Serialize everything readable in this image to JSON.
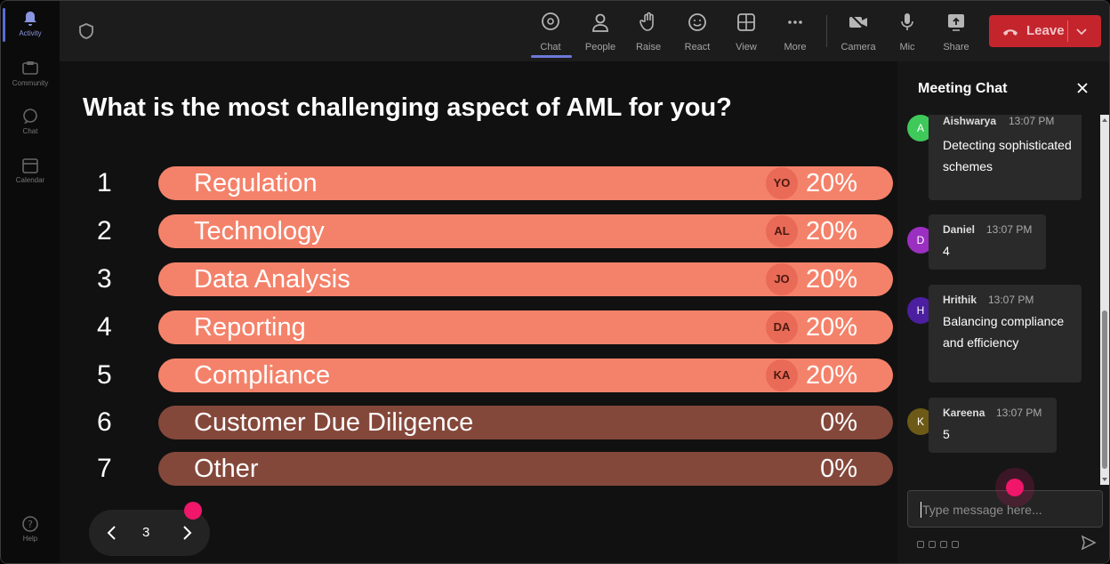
{
  "rail": {
    "items": [
      {
        "label": "Activity",
        "icon": "bell-icon"
      },
      {
        "label": "Community",
        "icon": "community-icon"
      },
      {
        "label": "Chat",
        "icon": "chat-bubble-icon"
      },
      {
        "label": "Calendar",
        "icon": "calendar-icon"
      },
      {
        "label": "Help",
        "icon": "help-icon"
      }
    ]
  },
  "toolbar": {
    "buttons": [
      {
        "label": "Chat",
        "icon": "chat-bubble-icon"
      },
      {
        "label": "People",
        "icon": "person-icon"
      },
      {
        "label": "Raise",
        "icon": "hand-icon"
      },
      {
        "label": "React",
        "icon": "smiley-icon"
      },
      {
        "label": "View",
        "icon": "grid-icon"
      },
      {
        "label": "More",
        "icon": "ellipsis-icon"
      },
      {
        "label": "Camera",
        "icon": "camera-off-icon"
      },
      {
        "label": "Mic",
        "icon": "mic-icon"
      },
      {
        "label": "Share",
        "icon": "share-screen-icon"
      }
    ],
    "leave_label": "Leave"
  },
  "poll": {
    "question": "What is the most challenging aspect of AML for you?",
    "options": [
      {
        "num": "1",
        "label": "Regulation",
        "avatar": "YO",
        "percent": "20%",
        "filled": true
      },
      {
        "num": "2",
        "label": "Technology",
        "avatar": "AL",
        "percent": "20%",
        "filled": true
      },
      {
        "num": "3",
        "label": "Data Analysis",
        "avatar": "JO",
        "percent": "20%",
        "filled": true
      },
      {
        "num": "4",
        "label": "Reporting",
        "avatar": "DA",
        "percent": "20%",
        "filled": true
      },
      {
        "num": "5",
        "label": "Compliance",
        "avatar": "KA",
        "percent": "20%",
        "filled": true
      },
      {
        "num": "6",
        "label": "Customer Due Diligence",
        "avatar": "",
        "percent": "0%",
        "filled": false
      },
      {
        "num": "7",
        "label": "Other",
        "avatar": "",
        "percent": "0%",
        "filled": false
      }
    ],
    "page": "3"
  },
  "chat": {
    "title": "Meeting Chat",
    "messages": [
      {
        "initial": "A",
        "name": "Aishwarya",
        "time": "13:07 PM",
        "text": "Detecting sophisticated schemes",
        "color": "#3ec95a"
      },
      {
        "initial": "D",
        "name": "Daniel",
        "time": "13:07 PM",
        "text": "4",
        "color": "#9b2fc2"
      },
      {
        "initial": "H",
        "name": "Hrithik",
        "time": "13:07 PM",
        "text": "Balancing compliance and efficiency",
        "color": "#4b1fa0"
      },
      {
        "initial": "K",
        "name": "Kareena",
        "time": "13:07 PM",
        "text": "5",
        "color": "#6e5a17"
      }
    ],
    "placeholder": "Type message here..."
  },
  "colors": {
    "accent": "#5b6bd6",
    "leave": "#c4252d",
    "bar_filled": "#f4826a",
    "bar_empty": "#84483b",
    "cursor_dot": "#f0166a"
  }
}
